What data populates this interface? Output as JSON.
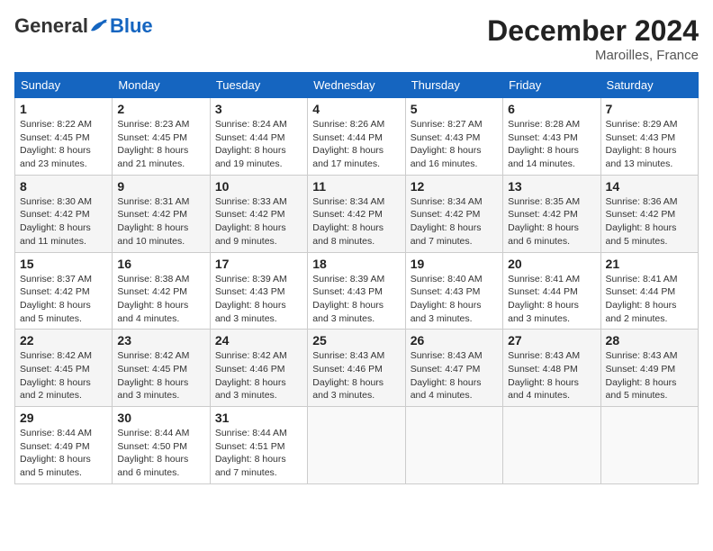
{
  "header": {
    "logo_general": "General",
    "logo_blue": "Blue",
    "month_title": "December 2024",
    "location": "Maroilles, France"
  },
  "weekdays": [
    "Sunday",
    "Monday",
    "Tuesday",
    "Wednesday",
    "Thursday",
    "Friday",
    "Saturday"
  ],
  "weeks": [
    [
      {
        "day": "1",
        "info": "Sunrise: 8:22 AM\nSunset: 4:45 PM\nDaylight: 8 hours\nand 23 minutes."
      },
      {
        "day": "2",
        "info": "Sunrise: 8:23 AM\nSunset: 4:45 PM\nDaylight: 8 hours\nand 21 minutes."
      },
      {
        "day": "3",
        "info": "Sunrise: 8:24 AM\nSunset: 4:44 PM\nDaylight: 8 hours\nand 19 minutes."
      },
      {
        "day": "4",
        "info": "Sunrise: 8:26 AM\nSunset: 4:44 PM\nDaylight: 8 hours\nand 17 minutes."
      },
      {
        "day": "5",
        "info": "Sunrise: 8:27 AM\nSunset: 4:43 PM\nDaylight: 8 hours\nand 16 minutes."
      },
      {
        "day": "6",
        "info": "Sunrise: 8:28 AM\nSunset: 4:43 PM\nDaylight: 8 hours\nand 14 minutes."
      },
      {
        "day": "7",
        "info": "Sunrise: 8:29 AM\nSunset: 4:43 PM\nDaylight: 8 hours\nand 13 minutes."
      }
    ],
    [
      {
        "day": "8",
        "info": "Sunrise: 8:30 AM\nSunset: 4:42 PM\nDaylight: 8 hours\nand 11 minutes."
      },
      {
        "day": "9",
        "info": "Sunrise: 8:31 AM\nSunset: 4:42 PM\nDaylight: 8 hours\nand 10 minutes."
      },
      {
        "day": "10",
        "info": "Sunrise: 8:33 AM\nSunset: 4:42 PM\nDaylight: 8 hours\nand 9 minutes."
      },
      {
        "day": "11",
        "info": "Sunrise: 8:34 AM\nSunset: 4:42 PM\nDaylight: 8 hours\nand 8 minutes."
      },
      {
        "day": "12",
        "info": "Sunrise: 8:34 AM\nSunset: 4:42 PM\nDaylight: 8 hours\nand 7 minutes."
      },
      {
        "day": "13",
        "info": "Sunrise: 8:35 AM\nSunset: 4:42 PM\nDaylight: 8 hours\nand 6 minutes."
      },
      {
        "day": "14",
        "info": "Sunrise: 8:36 AM\nSunset: 4:42 PM\nDaylight: 8 hours\nand 5 minutes."
      }
    ],
    [
      {
        "day": "15",
        "info": "Sunrise: 8:37 AM\nSunset: 4:42 PM\nDaylight: 8 hours\nand 5 minutes."
      },
      {
        "day": "16",
        "info": "Sunrise: 8:38 AM\nSunset: 4:42 PM\nDaylight: 8 hours\nand 4 minutes."
      },
      {
        "day": "17",
        "info": "Sunrise: 8:39 AM\nSunset: 4:43 PM\nDaylight: 8 hours\nand 3 minutes."
      },
      {
        "day": "18",
        "info": "Sunrise: 8:39 AM\nSunset: 4:43 PM\nDaylight: 8 hours\nand 3 minutes."
      },
      {
        "day": "19",
        "info": "Sunrise: 8:40 AM\nSunset: 4:43 PM\nDaylight: 8 hours\nand 3 minutes."
      },
      {
        "day": "20",
        "info": "Sunrise: 8:41 AM\nSunset: 4:44 PM\nDaylight: 8 hours\nand 3 minutes."
      },
      {
        "day": "21",
        "info": "Sunrise: 8:41 AM\nSunset: 4:44 PM\nDaylight: 8 hours\nand 2 minutes."
      }
    ],
    [
      {
        "day": "22",
        "info": "Sunrise: 8:42 AM\nSunset: 4:45 PM\nDaylight: 8 hours\nand 2 minutes."
      },
      {
        "day": "23",
        "info": "Sunrise: 8:42 AM\nSunset: 4:45 PM\nDaylight: 8 hours\nand 3 minutes."
      },
      {
        "day": "24",
        "info": "Sunrise: 8:42 AM\nSunset: 4:46 PM\nDaylight: 8 hours\nand 3 minutes."
      },
      {
        "day": "25",
        "info": "Sunrise: 8:43 AM\nSunset: 4:46 PM\nDaylight: 8 hours\nand 3 minutes."
      },
      {
        "day": "26",
        "info": "Sunrise: 8:43 AM\nSunset: 4:47 PM\nDaylight: 8 hours\nand 4 minutes."
      },
      {
        "day": "27",
        "info": "Sunrise: 8:43 AM\nSunset: 4:48 PM\nDaylight: 8 hours\nand 4 minutes."
      },
      {
        "day": "28",
        "info": "Sunrise: 8:43 AM\nSunset: 4:49 PM\nDaylight: 8 hours\nand 5 minutes."
      }
    ],
    [
      {
        "day": "29",
        "info": "Sunrise: 8:44 AM\nSunset: 4:49 PM\nDaylight: 8 hours\nand 5 minutes."
      },
      {
        "day": "30",
        "info": "Sunrise: 8:44 AM\nSunset: 4:50 PM\nDaylight: 8 hours\nand 6 minutes."
      },
      {
        "day": "31",
        "info": "Sunrise: 8:44 AM\nSunset: 4:51 PM\nDaylight: 8 hours\nand 7 minutes."
      },
      {
        "day": "",
        "info": ""
      },
      {
        "day": "",
        "info": ""
      },
      {
        "day": "",
        "info": ""
      },
      {
        "day": "",
        "info": ""
      }
    ]
  ]
}
